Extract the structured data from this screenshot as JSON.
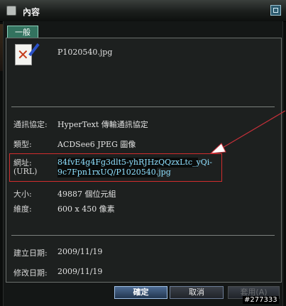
{
  "window": {
    "title": "內容"
  },
  "tabs": [
    {
      "label": "一般"
    }
  ],
  "file": {
    "name": "P1020540.jpg"
  },
  "properties": {
    "protocol_label": "通訊協定:",
    "protocol_value": "HyperText 傳輸通訊協定",
    "type_label": "類型:",
    "type_value": "ACDSee6 JPEG 圖像",
    "url_label_1": "網址:",
    "url_label_2": "(URL)",
    "url_line_1": "84fvE4g4Fg3dlt5-yhRJHzQQzxLtc_yQi-",
    "url_line_2": "9c7Fpn1rxUQ/P1020540.jpg",
    "size_label": "大小:",
    "size_value": "49887 個位元組",
    "dimensions_label": "維度:",
    "dimensions_value": "600 x 450 像素",
    "created_label": "建立日期:",
    "created_value": "2009/11/19",
    "modified_label": "修改日期:",
    "modified_value": "2009/11/19"
  },
  "buttons": {
    "ok": "確定",
    "cancel": "取消",
    "apply": "套用(A)"
  },
  "watermark": "#277333",
  "colors": {
    "highlight": "#d12d2d",
    "ok_button": "#4d6b92",
    "url_text": "#8fe0ff"
  }
}
